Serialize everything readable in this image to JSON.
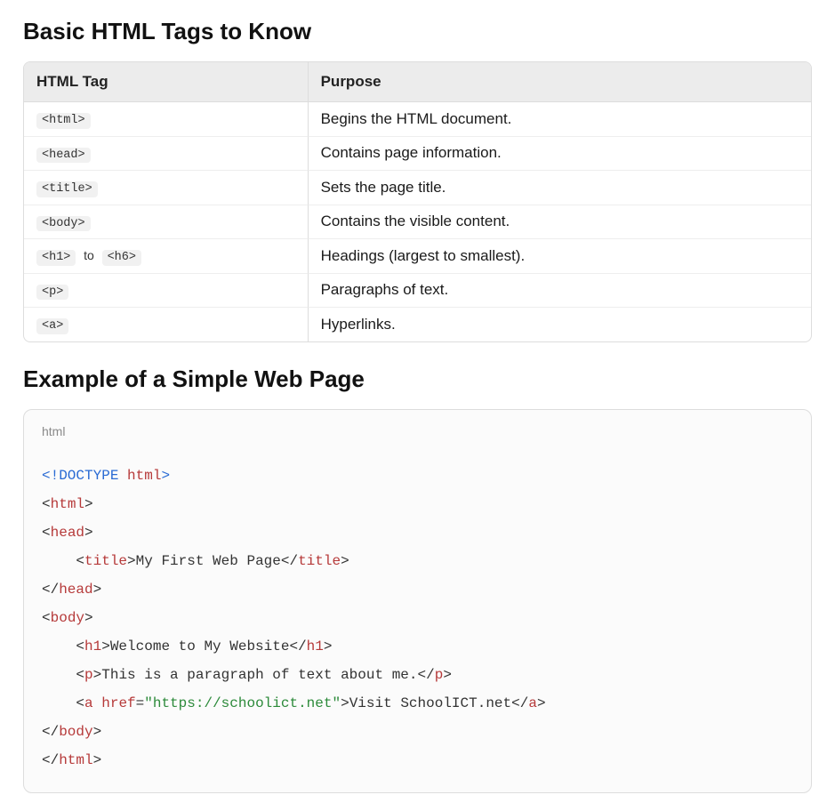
{
  "section1": {
    "title": "Basic HTML Tags to Know",
    "table": {
      "headers": [
        "HTML Tag",
        "Purpose"
      ],
      "rows": [
        {
          "tag": "<html>",
          "purpose": "Begins the HTML document."
        },
        {
          "tag": "<head>",
          "purpose": "Contains page information."
        },
        {
          "tag": "<title>",
          "purpose": "Sets the page title."
        },
        {
          "tag": "<body>",
          "purpose": "Contains the visible content."
        },
        {
          "tag_range_from": "<h1>",
          "tag_range_to": "<h6>",
          "between": "to",
          "purpose": "Headings (largest to smallest)."
        },
        {
          "tag": "<p>",
          "purpose": "Paragraphs of text."
        },
        {
          "tag": "<a>",
          "purpose": "Hyperlinks."
        }
      ]
    }
  },
  "section2": {
    "title": "Example of a Simple Web Page",
    "language_label": "html",
    "code": {
      "doctype_prefix": "<!DOCTYPE",
      "doctype_html": "html",
      "doctype_suffix": ">",
      "tags": {
        "html_open": "html",
        "head_open": "head",
        "title_open": "title",
        "title_text": "My First Web Page",
        "title_close": "title",
        "head_close": "head",
        "body_open": "body",
        "h1_open": "h1",
        "h1_text": "Welcome to My Website",
        "h1_close": "h1",
        "p_open": "p",
        "p_text": "This is a paragraph of text about me.",
        "p_close": "p",
        "a_open": "a",
        "a_attr": "href",
        "a_href": "\"https://schoolict.net\"",
        "a_text": "Visit SchoolICT.net",
        "a_close": "a",
        "body_close": "body",
        "html_close": "html"
      }
    }
  }
}
